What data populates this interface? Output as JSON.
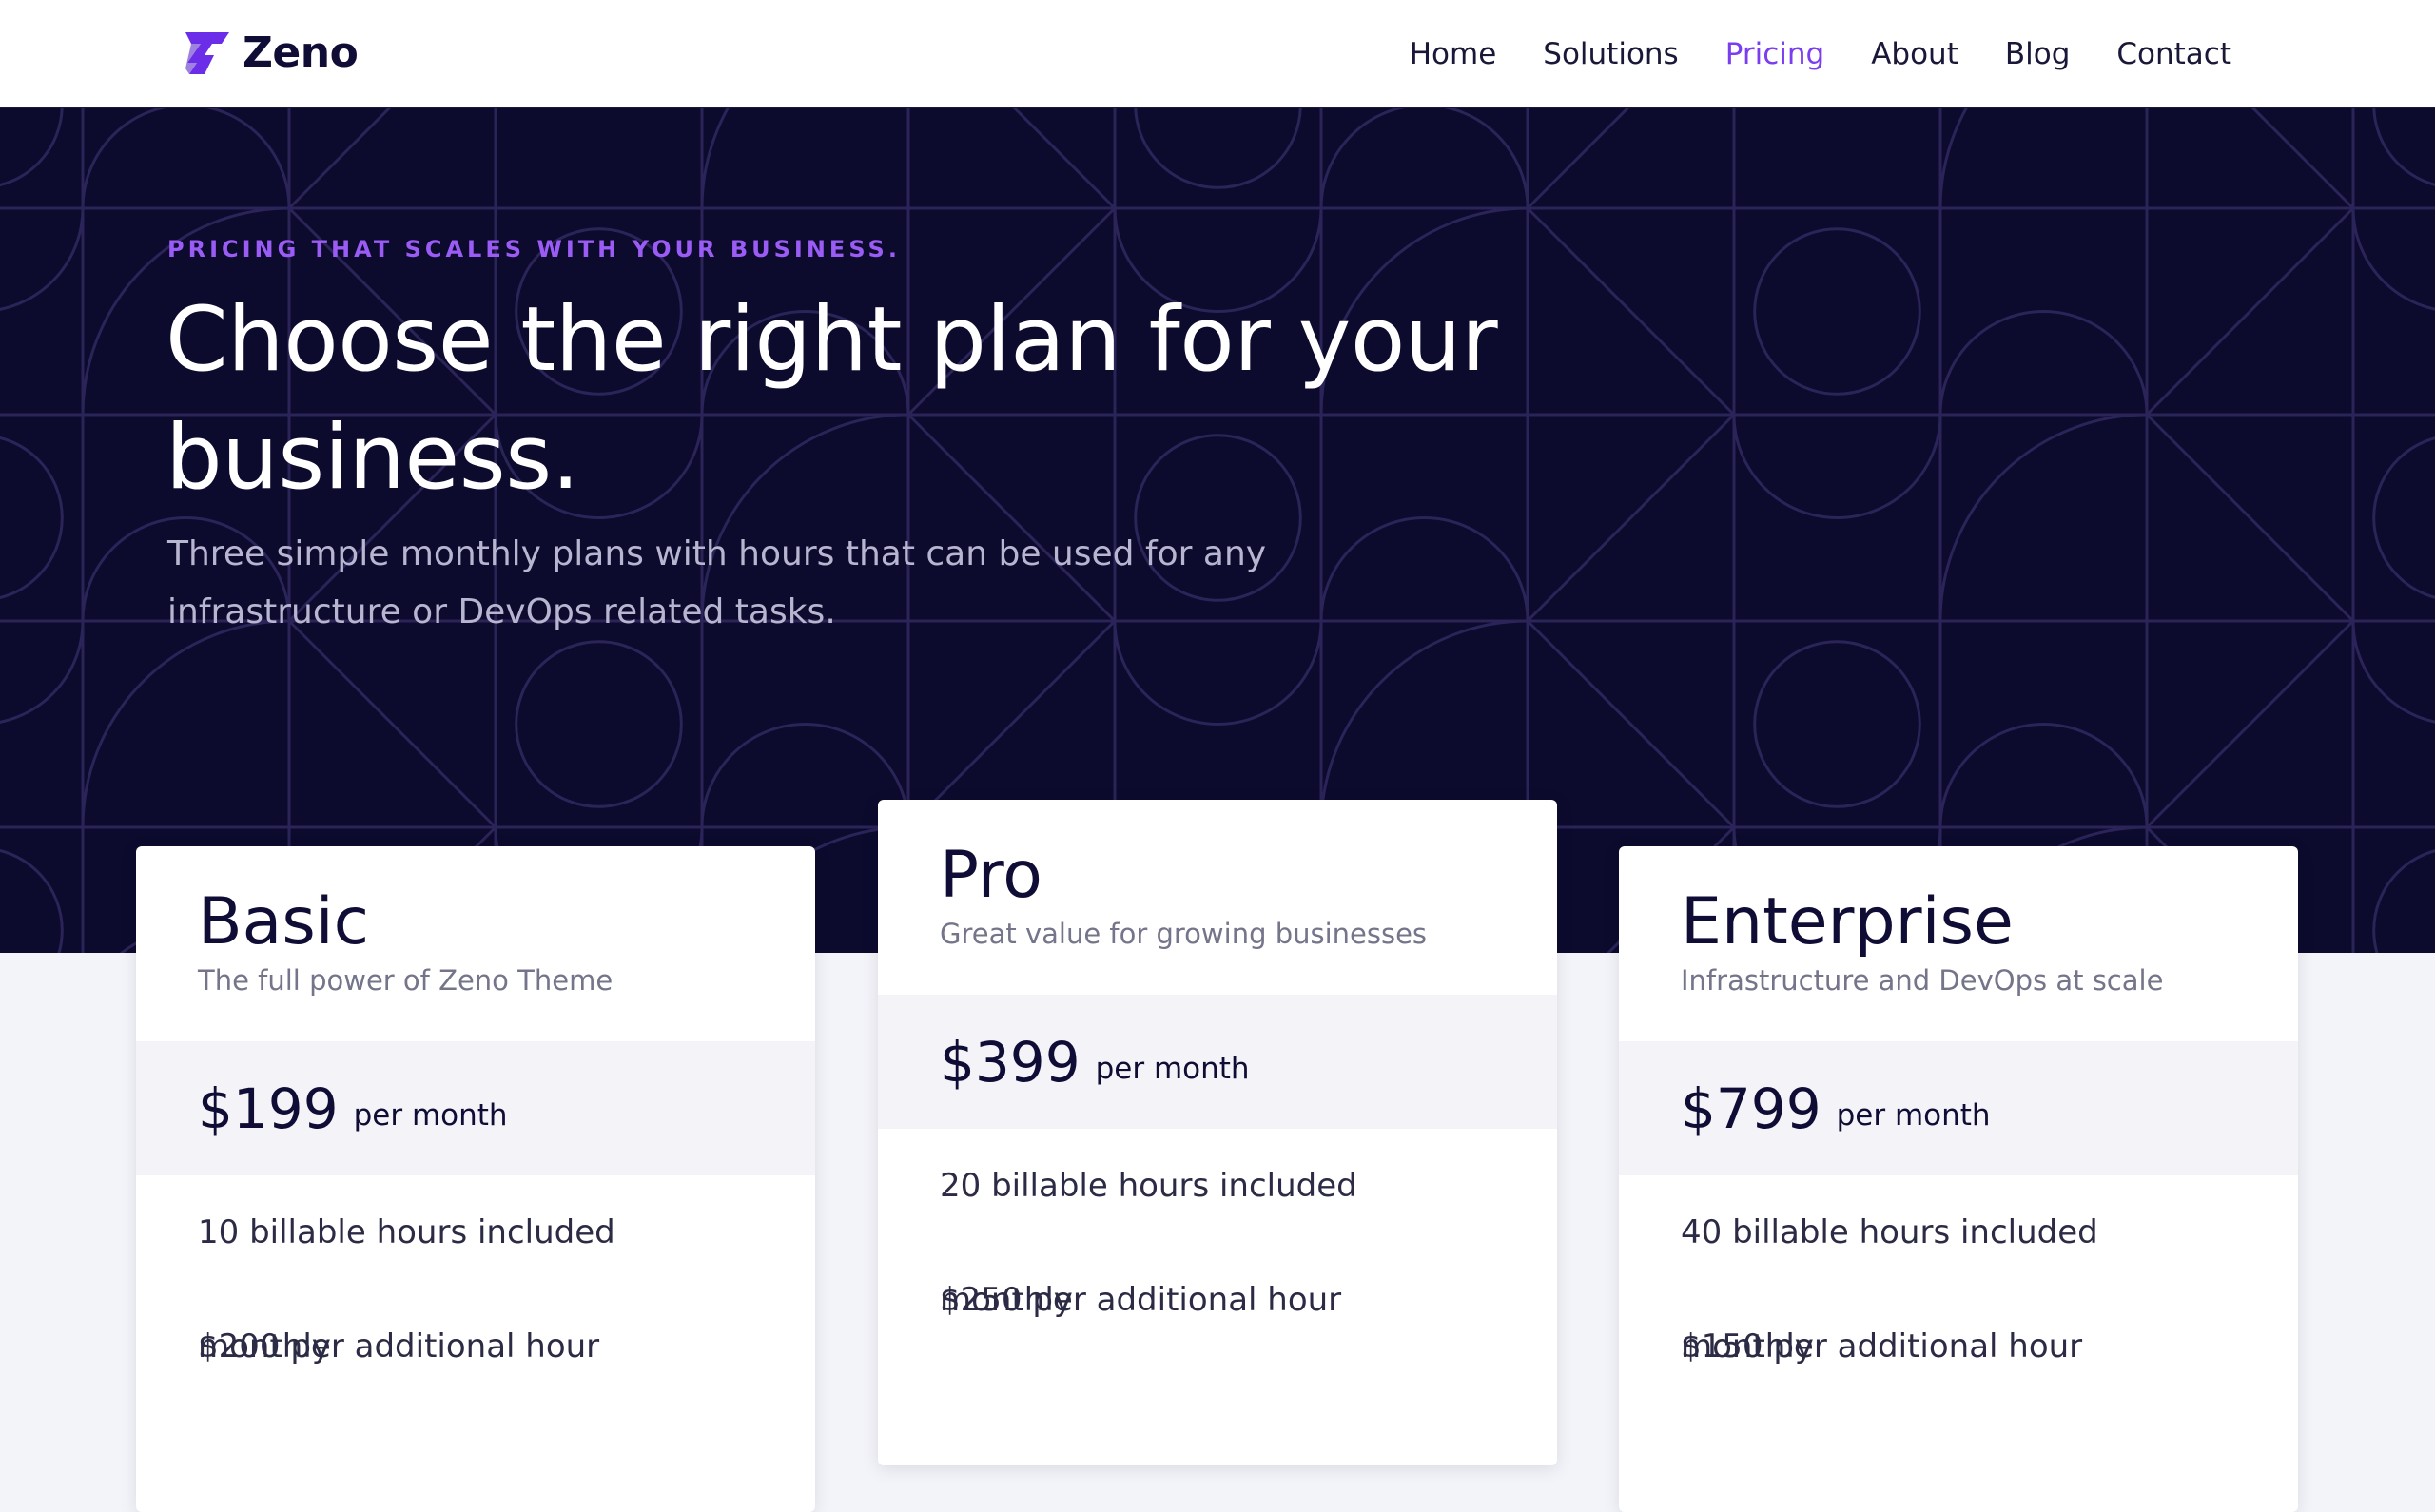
{
  "brand": {
    "name": "Zeno"
  },
  "nav": {
    "items": [
      {
        "label": "Home"
      },
      {
        "label": "Solutions"
      },
      {
        "label": "Pricing",
        "active": true
      },
      {
        "label": "About"
      },
      {
        "label": "Blog"
      },
      {
        "label": "Contact"
      }
    ]
  },
  "hero": {
    "eyebrow": "PRICING THAT SCALES WITH YOUR BUSINESS.",
    "title": "Choose the right plan for your business.",
    "subtitle": "Three simple monthly plans with hours that can be used for any infrastructure or DevOps related tasks."
  },
  "plans": [
    {
      "name": "Basic",
      "tagline": "The full power of Zeno Theme",
      "price": "$199",
      "period": "per month",
      "features": [
        "10 billable hours included monthly",
        "$200 per additional hour"
      ]
    },
    {
      "name": "Pro",
      "tagline": "Great value for growing businesses",
      "price": "$399",
      "period": "per month",
      "features": [
        "20 billable hours included monthly",
        "$250 per additional hour"
      ]
    },
    {
      "name": "Enterprise",
      "tagline": "Infrastructure and DevOps at scale",
      "price": "$799",
      "period": "per month",
      "features": [
        "40 billable hours included monthly",
        "$150 per additional hour"
      ]
    }
  ],
  "colors": {
    "accent": "#7a3df0",
    "hero_bg": "#0c0a2d",
    "pattern_line": "#2a2458",
    "price_band": "#f3f3f8"
  },
  "icons": {
    "logo": "lightning-z-icon"
  }
}
